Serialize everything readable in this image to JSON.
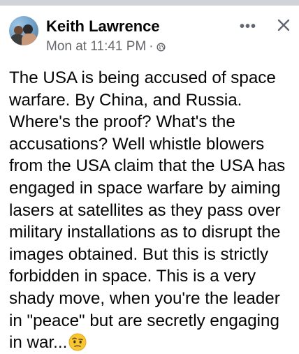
{
  "post": {
    "author": "Keith Lawrence",
    "timestamp": "Mon at 11:41 PM",
    "separator": "·",
    "privacy_icon": "globe-icon",
    "more_icon": "more-options-icon",
    "more_label": "•••",
    "close_icon": "close-icon",
    "avatar_icon": "profile-photo",
    "text": "The USA is being accused of space warfare. By China, and Russia. Where's the proof? What's the accusations? Well whistle blowers from the USA claim that the USA has engaged in space warfare by aiming lasers at satellites as they pass over military installations as to disrupt the images obtained. But this is strictly forbidden in space. This is a very shady move, when you're the leader in \"peace\" but are secretly engaging in war...",
    "emoji": "face-with-raised-eyebrow-emoji"
  },
  "colors": {
    "text_primary": "#050505",
    "text_secondary": "#65676b",
    "top_bar": "#d0d3d8",
    "background": "#ffffff"
  }
}
